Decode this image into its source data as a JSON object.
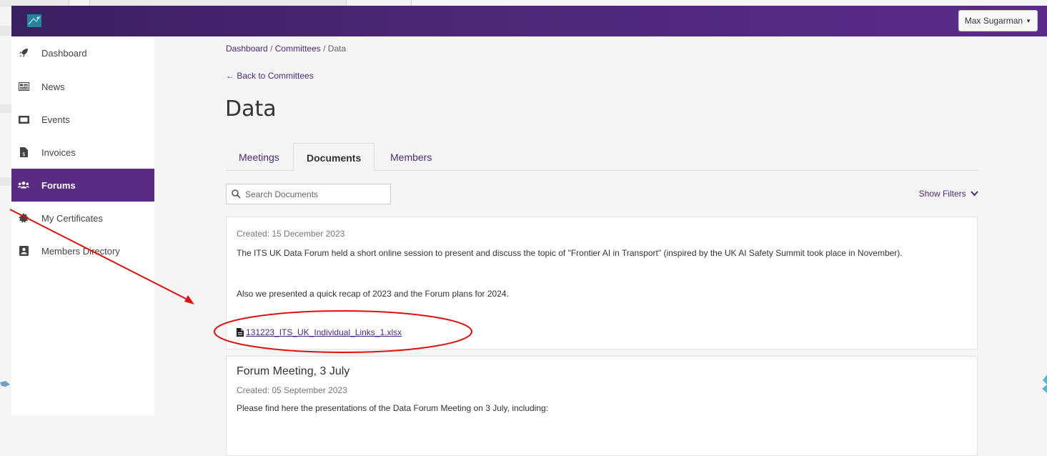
{
  "topbar": {
    "user_menu": "Max Sugarman"
  },
  "sidebar": {
    "items": [
      {
        "label": "Dashboard",
        "icon": "rocket-icon"
      },
      {
        "label": "News",
        "icon": "newspaper-icon"
      },
      {
        "label": "Events",
        "icon": "ticket-icon"
      },
      {
        "label": "Invoices",
        "icon": "invoice-icon"
      },
      {
        "label": "Forums",
        "icon": "users-icon",
        "active": true
      },
      {
        "label": "My Certificates",
        "icon": "certificate-icon"
      },
      {
        "label": "Members Directory",
        "icon": "address-book-icon"
      }
    ]
  },
  "breadcrumb": {
    "level1": "Dashboard",
    "sep": "/",
    "level2": "Committees",
    "current": "Data"
  },
  "back_link": "← Back to Committees",
  "page_title": "Data",
  "tabs": [
    {
      "label": "Meetings"
    },
    {
      "label": "Documents",
      "active": true
    },
    {
      "label": "Members"
    }
  ],
  "search": {
    "placeholder": "Search Documents"
  },
  "show_filters": "Show Filters",
  "documents": [
    {
      "created": "Created: 15 December 2023",
      "paragraph1": "The ITS UK Data Forum held a short online session to present and discuss the topic of \"Frontier AI in Transport\" (inspired by the UK AI Safety Summit took place in November).",
      "paragraph2": "Also we presented a quick recap of 2023 and the Forum plans for 2024.",
      "file": "131223_ITS_UK_Individual_Links_1.xlsx"
    },
    {
      "title": "Forum Meeting, 3 July",
      "created": "Created: 05 September 2023",
      "paragraph1": "Please find here the presentations of the Data Forum Meeting on 3 July, including:"
    }
  ],
  "colors": {
    "accent": "#5a2b82",
    "link": "#4a2b7a",
    "annotation": "#e01010"
  }
}
